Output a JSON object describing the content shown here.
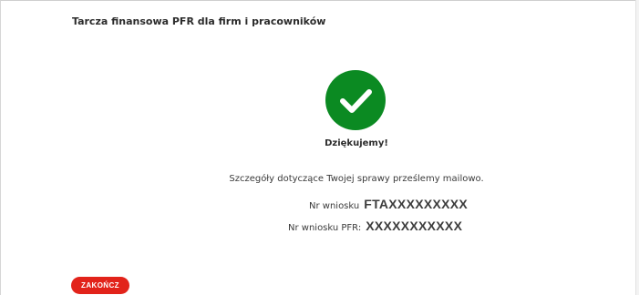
{
  "header": {
    "title": "Tarcza finansowa PFR dla firm i pracowników"
  },
  "confirmation": {
    "icon": "check-icon",
    "badge_color": "#0b8a22",
    "heading": "Dziękujemy!",
    "message": "Szczegóły dotyczące Twojej sprawy prześlemy mailowo.",
    "application_number_label": "Nr wniosku",
    "application_number_value": "FTAXXXXXXXXX",
    "pfr_number_label": "Nr wniosku PFR:",
    "pfr_number_value": "XXXXXXXXXXX"
  },
  "actions": {
    "finish_label": "ZAKOŃCZ",
    "finish_color": "#e2231a"
  }
}
